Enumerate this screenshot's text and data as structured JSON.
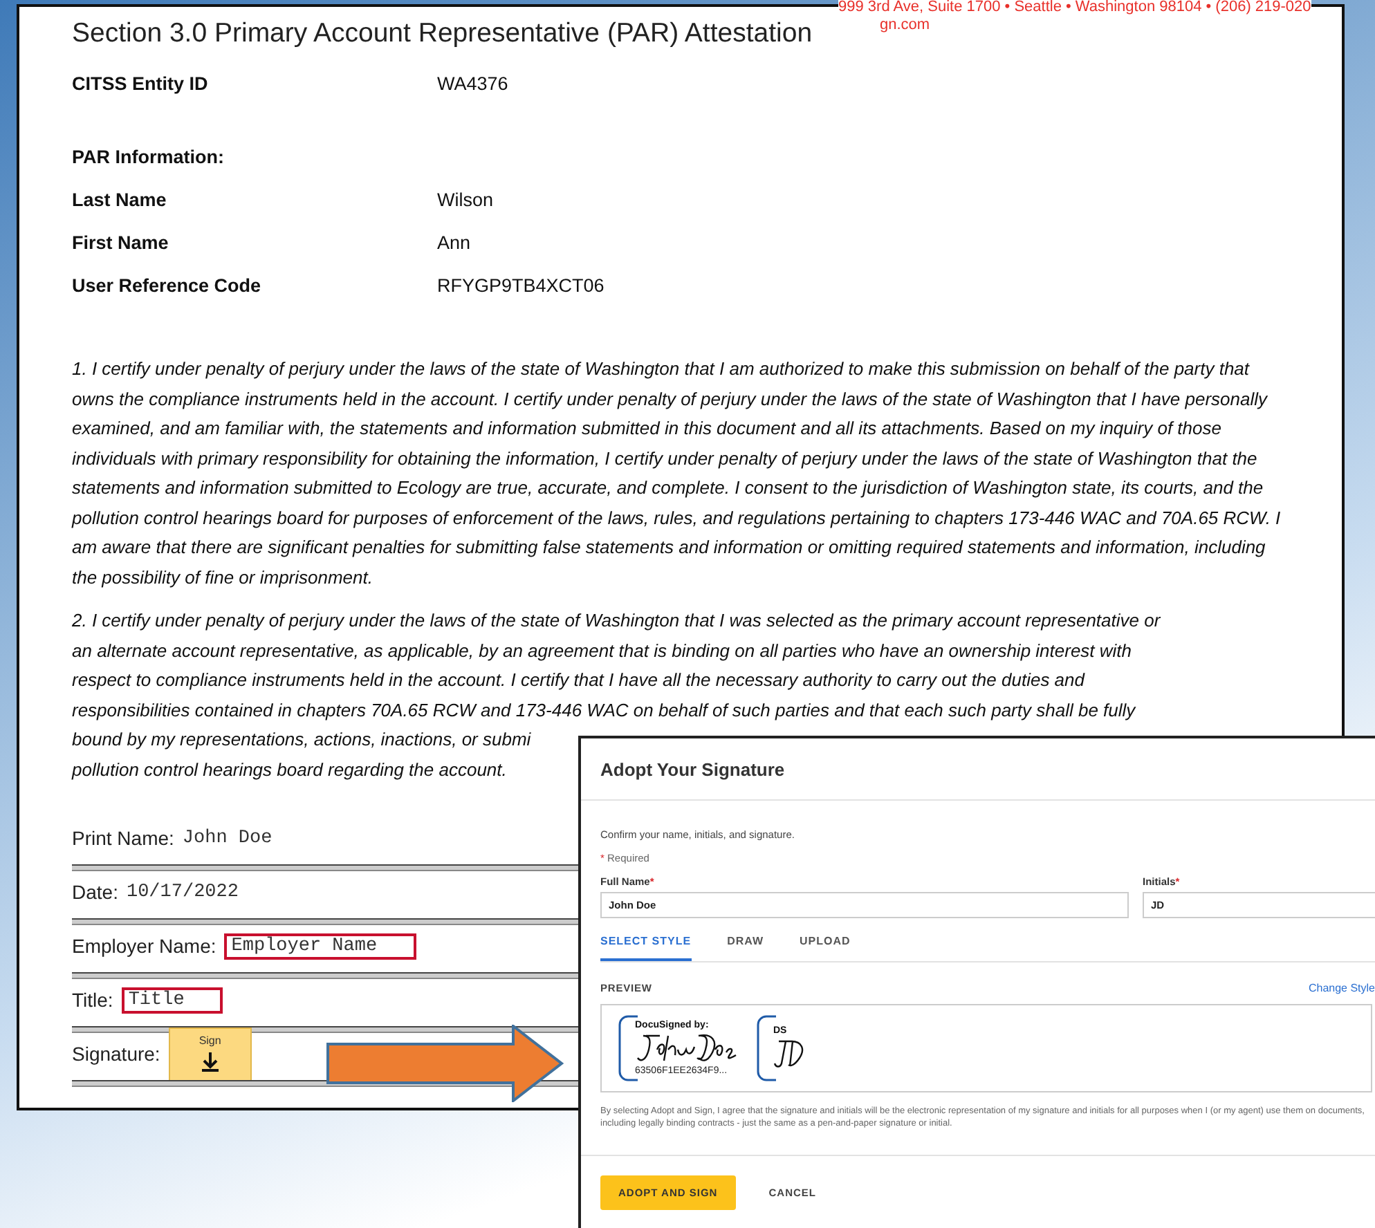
{
  "letterhead": {
    "address": "999 3rd Ave, Suite 1700 • Seattle • Washington 98104 • (206) 219-020",
    "website": "gn.com"
  },
  "section_title": "Section 3.0 Primary Account Representative (PAR) Attestation",
  "entity": {
    "label": "CITSS Entity ID",
    "value": "WA4376"
  },
  "par_heading": "PAR Information:",
  "par_fields": [
    {
      "label": "Last Name",
      "value": "Wilson"
    },
    {
      "label": "First Name",
      "value": "Ann"
    },
    {
      "label": "User Reference Code",
      "value": "RFYGP9TB4XCT06"
    }
  ],
  "paragraph_1": "1. I certify under penalty of perjury under the laws of the state of Washington that I am authorized to make this submission on behalf of the party that owns the compliance instruments held in the account. I certify under penalty of perjury under the laws of the state of Washington that I have personally examined, and am familiar with, the statements and information submitted in this document and all its attachments. Based on my inquiry of those individuals with primary responsibility for obtaining the information, I certify under penalty of perjury under the laws of the state of Washington that the statements and information submitted to Ecology are true, accurate, and complete. I consent to the jurisdiction of Washington state, its courts, and the pollution control hearings board for purposes of enforcement of the laws, rules, and regulations pertaining to chapters 173-446 WAC and 70A.65 RCW. I am aware that there are significant penalties for submitting false statements and information or omitting required statements and information, including the possibility of fine or imprisonment.",
  "paragraph_2_lines": [
    "2. I certify under penalty of perjury under the laws of the state of Washington that I was selected as the primary account representative or",
    "an alternate account representative, as applicable, by an agreement that is binding on all parties who have an ownership interest with",
    "respect to compliance instruments held in the account. I certify that I have all the necessary authority to carry out the duties and",
    "responsibilities contained in chapters 70A.65 RCW and 173-446 WAC on behalf of such parties and that each such party shall be fully",
    "bound by my representations, actions, inactions, or submi",
    "pollution control hearings board regarding the account."
  ],
  "form_rows": [
    {
      "kind": "text",
      "label": "Print Name:",
      "value": "John Doe"
    },
    {
      "kind": "text",
      "label": "Date:",
      "value": "10/17/2022"
    },
    {
      "kind": "field",
      "label": "Employer Name:",
      "value": "Employer Name"
    },
    {
      "kind": "field",
      "label": "Title:",
      "value": "Title"
    },
    {
      "kind": "sign",
      "label": "Signature:",
      "value": "Sign"
    }
  ],
  "dialog": {
    "title": "Adopt Your Signature",
    "intro": "Confirm your name, initials, and signature.",
    "required_note": {
      "mark": "*",
      "text": "Required"
    },
    "fields": [
      {
        "label": "Full Name",
        "mark": "*",
        "value": "John Doe"
      },
      {
        "label": "Initials",
        "mark": "*",
        "value": "JD"
      }
    ],
    "tabs": [
      {
        "label": "SELECT STYLE",
        "selected": true
      },
      {
        "label": "DRAW",
        "selected": false
      },
      {
        "label": "UPLOAD",
        "selected": false
      }
    ],
    "preview_label": "PREVIEW",
    "change_style": "Change Style",
    "signature_stamp": {
      "caption": "DocuSigned by:",
      "hash": "63506F1EE2634F9..."
    },
    "initials_stamp": {
      "caption": "DS"
    },
    "disclaimer": "By selecting Adopt and Sign, I agree that the signature and initials will be the electronic representation of my signature and initials for all purposes when I (or my agent) use them on documents, including legally binding contracts - just the same as a pen-and-paper signature or initial.",
    "buttons": [
      {
        "kind": "primary",
        "label": "ADOPT AND SIGN"
      },
      {
        "kind": "plain",
        "label": "CANCEL"
      }
    ]
  }
}
